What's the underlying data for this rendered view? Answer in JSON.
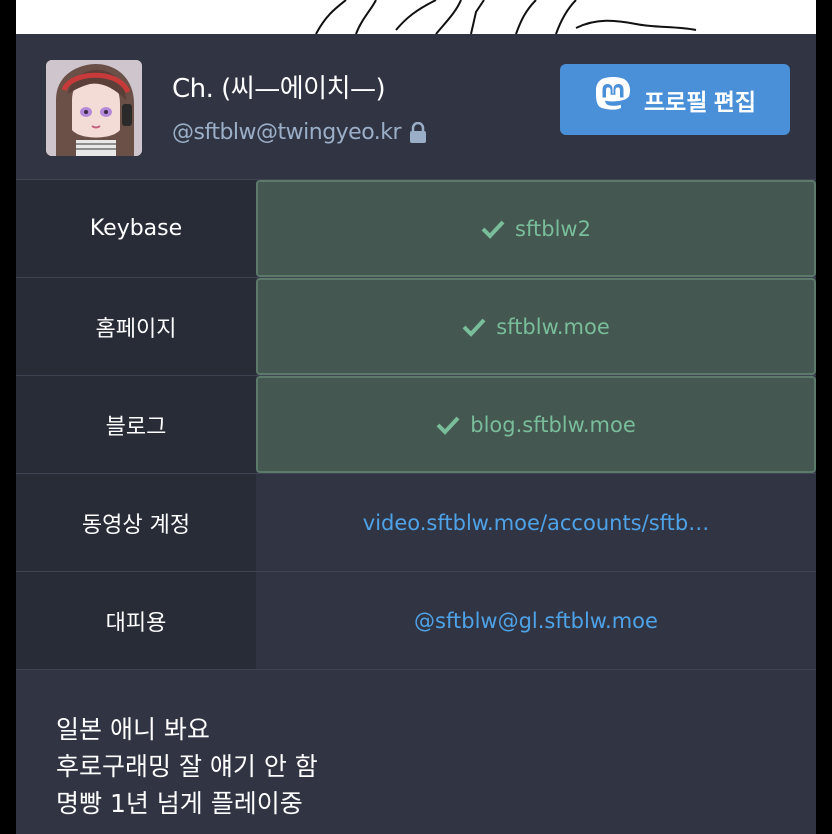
{
  "profile": {
    "display_name": "Ch. (씨—에이치—)",
    "acct": "@sftblw@twingyeo.kr",
    "edit_button_label": "프로필 편집"
  },
  "fields": [
    {
      "key": "Keybase",
      "value": "sftblw2",
      "verified": true
    },
    {
      "key": "홈페이지",
      "value": "sftblw.moe",
      "verified": true
    },
    {
      "key": "블로그",
      "value": "blog.sftblw.moe",
      "verified": true
    },
    {
      "key": "동영상 계정",
      "value": "video.sftblw.moe/accounts/sftb…",
      "verified": false
    },
    {
      "key": "대피용",
      "value": "@sftblw@gl.sftblw.moe",
      "verified": false
    }
  ],
  "note": {
    "lines": [
      "일본 애니 봐요",
      "후로구래밍 잘 얘기 안 함",
      "명빵 1년 넘게 플레이중"
    ]
  },
  "colors": {
    "card_bg": "#313543",
    "key_bg": "#282c37",
    "verified_bg": "#445750",
    "verified_text": "#79bd9a",
    "link": "#4ea2e8",
    "accent_button": "#4a90d9"
  },
  "icons": {
    "lock": "lock-icon",
    "check": "check-icon",
    "mastodon": "mastodon-icon"
  }
}
